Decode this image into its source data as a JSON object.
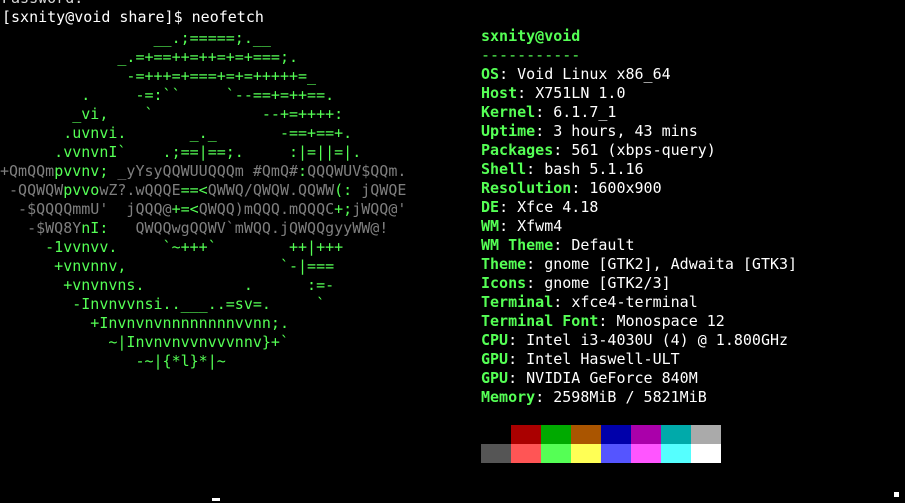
{
  "terminal": {
    "previous_line": "Password:",
    "prompt": "[sxnity@void share]$ neofetch"
  },
  "logo_lines": [
    [
      {
        "t": "                 __.;=====;.__",
        "c": "g"
      }
    ],
    [
      {
        "t": "             _.=+==++=++=+=+===;.",
        "c": "g"
      }
    ],
    [
      {
        "t": "              -=+++=+===+=+=+++++=_",
        "c": "g"
      }
    ],
    [
      {
        "t": "         .     -=:``     `--==+=++==.",
        "c": "g"
      }
    ],
    [
      {
        "t": "        _vi,    `            --+=++++:",
        "c": "g"
      }
    ],
    [
      {
        "t": "       .uvnvi.       _._       -==+==+.",
        "c": "g"
      }
    ],
    [
      {
        "t": "      .vvnvnI`    .;==|==;.     :|=||=|.",
        "c": "g"
      }
    ],
    [
      {
        "t": "+QmQQm",
        "c": "d"
      },
      {
        "t": "pvvnv;",
        "c": "g"
      },
      {
        "t": " _yYsyQQWUUQQQm #QmQ#",
        "c": "d"
      },
      {
        "t": ":",
        "c": "g"
      },
      {
        "t": "QQQWUV$QQm.",
        "c": "d"
      }
    ],
    [
      {
        "t": " -QQWQW",
        "c": "d"
      },
      {
        "t": "pvvo",
        "c": "g"
      },
      {
        "t": "wZ?.wQQQE",
        "c": "d"
      },
      {
        "t": "==<",
        "c": "g"
      },
      {
        "t": "QWWQ/QWQW.QQWW",
        "c": "d"
      },
      {
        "t": "(:",
        "c": "g"
      },
      {
        "t": " jQWQE",
        "c": "d"
      }
    ],
    [
      {
        "t": "  -$QQQQmmU'  jQQQ@",
        "c": "d"
      },
      {
        "t": "+=<",
        "c": "g"
      },
      {
        "t": "QWQQ)mQQQ.mQQQC",
        "c": "d"
      },
      {
        "t": "+;",
        "c": "g"
      },
      {
        "t": "jWQQ@'",
        "c": "d"
      }
    ],
    [
      {
        "t": "   -$WQ8Y",
        "c": "d"
      },
      {
        "t": "nI:",
        "c": "g"
      },
      {
        "t": "   QWQQwgQQWV`mWQQ.jQWQQgyyWW@!",
        "c": "d"
      }
    ],
    [
      {
        "t": "     -1vvnvv.     `~+++`        ++|+++",
        "c": "g"
      }
    ],
    [
      {
        "t": "      +vnvnnv,                 `-|===",
        "c": "g"
      }
    ],
    [
      {
        "t": "       +vnvnvns.           .      :=-",
        "c": "g"
      }
    ],
    [
      {
        "t": "        -Invnvvnsi..___..=sv=.     `",
        "c": "g"
      }
    ],
    [
      {
        "t": "          +Invnvnvnnnnnnnnvvnn;.",
        "c": "g"
      }
    ],
    [
      {
        "t": "            ~|Invnvnvvnvvvnnv}+`",
        "c": "g"
      }
    ],
    [
      {
        "t": "               -~|{*l}*|~",
        "c": "g"
      }
    ]
  ],
  "info": {
    "title": "sxnity@void",
    "separator": "-----------",
    "fields": [
      {
        "key": "OS",
        "value": "Void Linux x86_64"
      },
      {
        "key": "Host",
        "value": "X751LN 1.0"
      },
      {
        "key": "Kernel",
        "value": "6.1.7_1"
      },
      {
        "key": "Uptime",
        "value": "3 hours, 43 mins"
      },
      {
        "key": "Packages",
        "value": "561 (xbps-query)"
      },
      {
        "key": "Shell",
        "value": "bash 5.1.16"
      },
      {
        "key": "Resolution",
        "value": "1600x900"
      },
      {
        "key": "DE",
        "value": "Xfce 4.18"
      },
      {
        "key": "WM",
        "value": "Xfwm4"
      },
      {
        "key": "WM Theme",
        "value": "Default"
      },
      {
        "key": "Theme",
        "value": "gnome [GTK2], Adwaita [GTK3]"
      },
      {
        "key": "Icons",
        "value": "gnome [GTK2/3]"
      },
      {
        "key": "Terminal",
        "value": "xfce4-terminal"
      },
      {
        "key": "Terminal Font",
        "value": "Monospace 12"
      },
      {
        "key": "CPU",
        "value": "Intel i3-4030U (4) @ 1.800GHz"
      },
      {
        "key": "GPU",
        "value": "Intel Haswell-ULT"
      },
      {
        "key": "GPU",
        "value": "NVIDIA GeForce 840M"
      },
      {
        "key": "Memory",
        "value": "2598MiB / 5821MiB"
      }
    ]
  },
  "palette": {
    "normal": [
      "#000000",
      "#aa0000",
      "#00aa00",
      "#aa5500",
      "#0000aa",
      "#aa00aa",
      "#00aaaa",
      "#aaaaaa"
    ],
    "bright": [
      "#555555",
      "#ff5555",
      "#55ff55",
      "#ffff55",
      "#5555ff",
      "#ff55ff",
      "#55ffff",
      "#ffffff"
    ]
  },
  "colors": {
    "background": "#000000",
    "accent_green": "#55ff55",
    "logo_gray": "#7f7f7f",
    "text": "#ffffff"
  }
}
